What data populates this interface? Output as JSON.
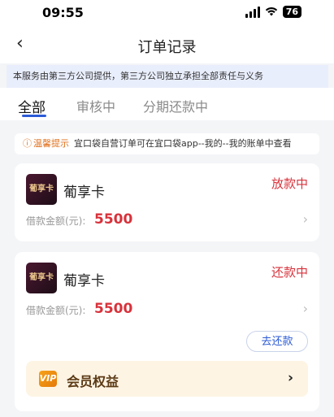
{
  "status_bar": {
    "time": "09:55",
    "wifi": "wifi-icon",
    "battery": "76"
  },
  "nav": {
    "back_icon": "‹",
    "title": "订单记录"
  },
  "notice": "本服务由第三方公司提供，第三方公司独立承担全部责任与义务",
  "tabs": [
    {
      "label": "全部",
      "active": true
    },
    {
      "label": "审核中",
      "active": false
    },
    {
      "label": "分期还款中",
      "active": false
    }
  ],
  "tip": {
    "icon": "ⓘ",
    "label": "温馨提示",
    "text": "宜口袋自营订单可在宜口袋app--我的--我的账单中查看"
  },
  "orders": [
    {
      "logo_text": "葡享卡",
      "name": "葡享卡",
      "status": "放款中",
      "amount_label": "借款金额(元):",
      "amount": "5500"
    },
    {
      "logo_text": "葡享卡",
      "name": "葡享卡",
      "status": "还款中",
      "amount_label": "借款金额(元):",
      "amount": "5500",
      "repay_button": "去还款",
      "member": {
        "icon_text": "VIP",
        "label": "会员权益"
      }
    }
  ],
  "colors": {
    "accent": "#2c5bd6",
    "status_red": "#d8323b",
    "tip_orange": "#e0701c",
    "banner_bg": "#e9eefc"
  }
}
